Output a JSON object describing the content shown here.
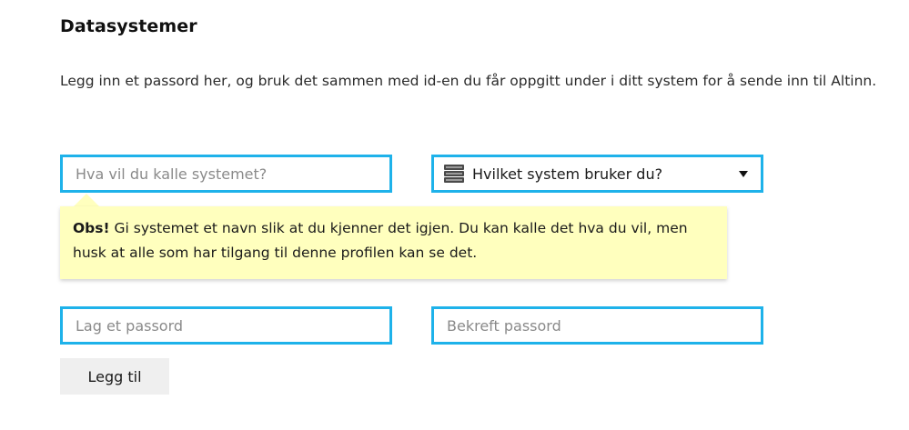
{
  "section": {
    "title": "Datasystemer",
    "intro": "Legg inn et passord her, og bruk det sammen med id-en du får oppgitt under i ditt system for å sende inn til Altinn."
  },
  "form": {
    "system_name_placeholder": "Hva vil du kalle systemet?",
    "system_select": {
      "selected_label": "Hvilket system bruker du?",
      "icon": "server-icon"
    },
    "password_placeholder": "Lag et passord",
    "confirm_password_placeholder": "Bekreft passord",
    "add_button_label": "Legg til"
  },
  "tooltip": {
    "prefix": "Obs!",
    "text": " Gi systemet et navn slik at du kjenner det igjen. Du kan kalle det hva du vil, men husk at alle som har tilgang til denne profilen kan se det."
  },
  "colors": {
    "accent": "#1eb2ea",
    "tooltip_bg": "#ffffbe",
    "button_bg": "#efefef"
  }
}
